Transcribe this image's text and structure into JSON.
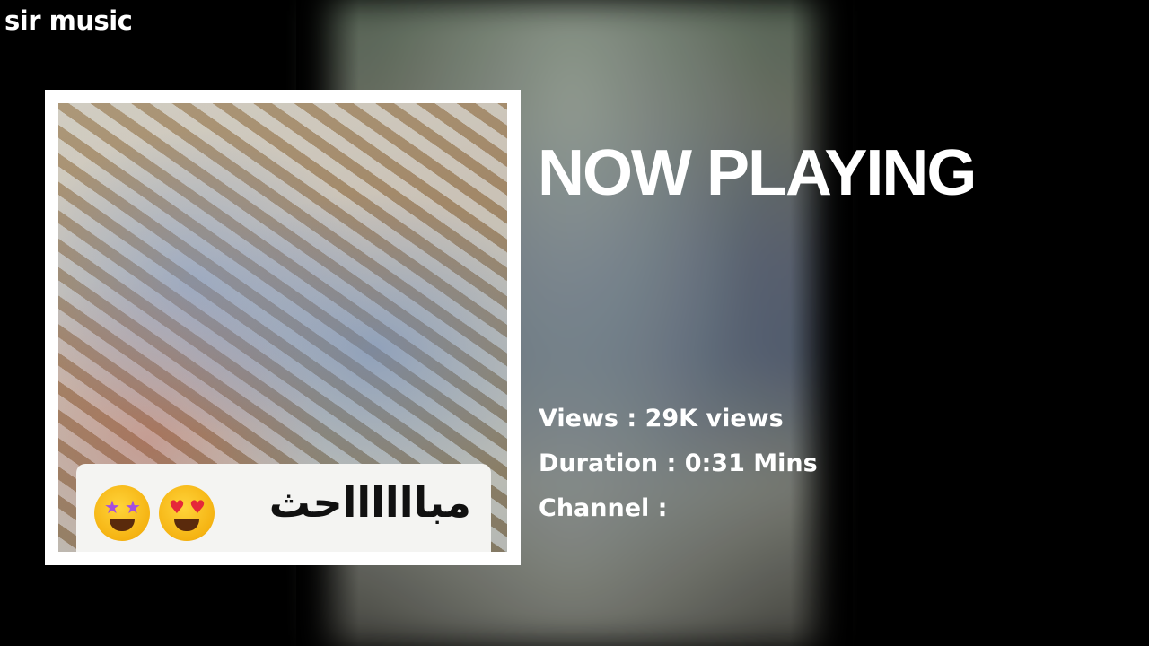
{
  "app": {
    "brand": "sir music"
  },
  "player": {
    "heading": "NOW PLAYING",
    "views_line": "Views : 29K views",
    "duration_line": "Duration : 0:31 Mins",
    "channel_line": "Channel :"
  },
  "artwork": {
    "caption": "مبااااااحث"
  },
  "colors": {
    "background": "#000000",
    "text": "#ffffff",
    "frame": "#ffffff"
  },
  "icons": [
    "star-struck-emoji-icon",
    "heart-eyes-emoji-icon"
  ]
}
